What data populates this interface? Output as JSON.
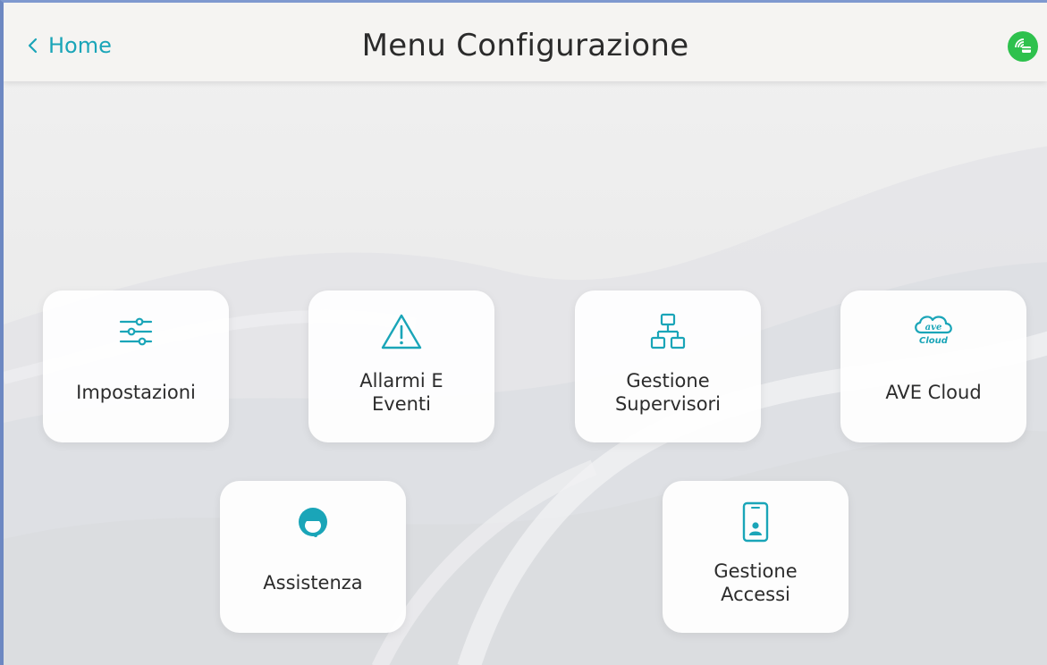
{
  "header": {
    "back_label": "Home",
    "title": "Menu Configurazione",
    "status_icon": "remote-connection-icon",
    "status_color": "#2ec14d"
  },
  "accent_color": "#1aa5b8",
  "tiles": [
    {
      "label": "Impostazioni",
      "icon": "sliders-icon"
    },
    {
      "label": "Allarmi E\nEventi",
      "icon": "warning-icon"
    },
    {
      "label": "Gestione\nSupervisori",
      "icon": "hierarchy-icon"
    },
    {
      "label": "AVE Cloud",
      "icon": "ave-cloud-icon",
      "icon_text_top": "ave",
      "icon_text_bottom": "Cloud"
    },
    {
      "label": "Assistenza",
      "icon": "headset-icon"
    },
    {
      "label": "Gestione\nAccessi",
      "icon": "tablet-user-icon"
    }
  ]
}
